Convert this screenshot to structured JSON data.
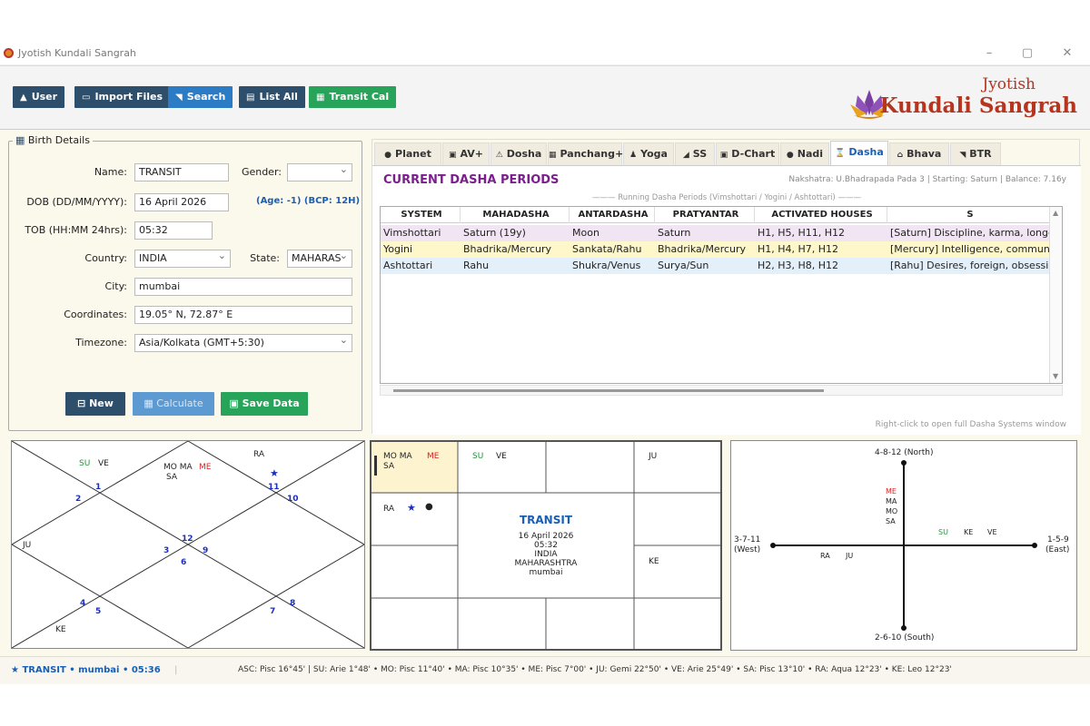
{
  "window": {
    "title": "Jyotish Kundali Sangrah",
    "minimize": "–",
    "maximize": "▢",
    "close": "✕"
  },
  "toolbar": {
    "buttons": [
      {
        "label": "User",
        "icon": "user-icon",
        "glyph": "▲",
        "color": "#2d4f6c"
      },
      {
        "label": "Import Files",
        "icon": "folder-icon",
        "glyph": "▭",
        "color": "#2d4f6c"
      },
      {
        "label": "Search",
        "icon": "search-icon",
        "glyph": "◥",
        "color": "#2b7cc4"
      },
      {
        "label": "List All",
        "icon": "list-icon",
        "glyph": "▤",
        "color": "#2d4f6c"
      },
      {
        "label": "Transit Cal",
        "icon": "calendar-icon",
        "glyph": "▦",
        "color": "#27a35a"
      }
    ]
  },
  "logo": {
    "line1": "Jyotish",
    "line2": "Kundali Sangrah"
  },
  "birth": {
    "legend": "Birth Details",
    "name_label": "Name:",
    "name_value": "TRANSIT",
    "gender_label": "Gender:",
    "gender_value": "",
    "dob_label": "DOB (DD/MM/YYYY):",
    "dob_value": "16 April 2026",
    "age_text": "(Age: -1) (BCP: 12H)",
    "tob_label": "TOB (HH:MM 24hrs):",
    "tob_value": "05:32",
    "country_label": "Country:",
    "country_value": "INDIA",
    "state_label": "State:",
    "state_value": "MAHARAS",
    "city_label": "City:",
    "city_value": "mumbai",
    "coord_label": "Coordinates:",
    "coord_value": "19.05° N, 72.87° E",
    "tz_label": "Timezone:",
    "tz_value": "Asia/Kolkata (GMT+5:30)",
    "new_label": "New",
    "calc_label": "Calculate",
    "save_label": "Save Data"
  },
  "tabs": [
    {
      "label": "Planet",
      "icon": "planet-icon",
      "glyph": "●"
    },
    {
      "label": "AV+",
      "icon": "av-icon",
      "glyph": "▣"
    },
    {
      "label": "Dosha",
      "icon": "warning-icon",
      "glyph": "⚠"
    },
    {
      "label": "Panchang+",
      "icon": "calendar-icon",
      "glyph": "▦"
    },
    {
      "label": "Yoga",
      "icon": "yoga-icon",
      "glyph": "♟"
    },
    {
      "label": "SS",
      "icon": "ss-icon",
      "glyph": "◢"
    },
    {
      "label": "D-Chart",
      "icon": "chart-icon",
      "glyph": "▣"
    },
    {
      "label": "Nadi",
      "icon": "nadi-icon",
      "glyph": "●"
    },
    {
      "label": "Dasha",
      "icon": "hourglass-icon",
      "glyph": "⌛",
      "active": true
    },
    {
      "label": "Bhava",
      "icon": "house-icon",
      "glyph": "⌂"
    },
    {
      "label": "BTR",
      "icon": "btr-icon",
      "glyph": "◥"
    }
  ],
  "dasha": {
    "title": "CURRENT DASHA PERIODS",
    "nakshatra": "Nakshatra: U.Bhadrapada Pada 3 | Starting: Saturn | Balance: 7.16y",
    "running": "——— Running Dasha Periods (Vimshottari / Yogini / Ashtottari) ———",
    "headers": [
      "SYSTEM",
      "MAHADASHA",
      "ANTARDASHA",
      "PRATYANTAR",
      "ACTIVATED HOUSES",
      "S"
    ],
    "rows": [
      {
        "bg": "#f1e4f3",
        "cells": [
          "Vimshottari",
          "Saturn (19y)",
          "Moon",
          "Saturn",
          "H1, H5, H11, H12",
          "[Saturn] Discipline, karma, longe"
        ]
      },
      {
        "bg": "#fdf7c9",
        "cells": [
          "Yogini",
          "Bhadrika/Mercury",
          "Sankata/Rahu",
          "Bhadrika/Mercury",
          "H1, H4, H7, H12",
          "[Mercury] Intelligence, communi"
        ]
      },
      {
        "bg": "#e3f0fa",
        "cells": [
          "Ashtottari",
          "Rahu",
          "Shukra/Venus",
          "Surya/Sun",
          "H2, H3, H8, H12",
          "[Rahu] Desires, foreign, obsessio"
        ]
      }
    ],
    "hint": "Right-click to open full Dasha Systems window"
  },
  "north_chart": {
    "houses": [
      {
        "num": "1"
      },
      {
        "num": "2"
      },
      {
        "num": "3"
      },
      {
        "num": "4"
      },
      {
        "num": "5"
      },
      {
        "num": "6"
      },
      {
        "num": "7"
      },
      {
        "num": "8"
      },
      {
        "num": "9"
      },
      {
        "num": "10"
      },
      {
        "num": "11"
      },
      {
        "num": "12"
      }
    ],
    "planets": [
      {
        "text": "SU",
        "color": "#1e9a3a"
      },
      {
        "text": "VE",
        "color": "#222"
      },
      {
        "text": "MO MA",
        "color": "#222"
      },
      {
        "text": "ME",
        "color": "#e02020"
      },
      {
        "text": "SA",
        "color": "#222"
      },
      {
        "text": "RA",
        "color": "#222"
      },
      {
        "text": "JU",
        "color": "#222"
      },
      {
        "text": "KE",
        "color": "#222"
      }
    ]
  },
  "south_chart": {
    "center_title": "TRANSIT",
    "center_lines": [
      "16 April 2026",
      "05:32",
      "INDIA",
      "MAHARASHTRA",
      "mumbai"
    ],
    "cells": {
      "c0_a": "MO MA",
      "c0_b": "ME",
      "c0_c": "SA",
      "c1_a": "SU",
      "c1_b": "VE",
      "c3": "JU",
      "c4": "RA",
      "c11": "KE"
    }
  },
  "cross_chart": {
    "north": "4-8-12 (North)",
    "south": "2-6-10 (South)",
    "west": "3-7-11",
    "west2": "(West)",
    "east": "1-5-9",
    "east2": "(East)",
    "n_planets": [
      "ME",
      "MA",
      "MO",
      "SA"
    ],
    "e_planets": [
      "SU",
      "KE",
      "VE"
    ],
    "w_planets": [
      "RA",
      "JU"
    ]
  },
  "status": {
    "left": "★ TRANSIT • mumbai • 05:36",
    "sep": "|",
    "right": "ASC: Pisc 16°45'  |  SU: Arie 1°48'  •  MO: Pisc 11°40'  •  MA: Pisc 10°35'  •  ME: Pisc 7°00'  •  JU: Gemi 22°50'  •  VE: Arie 25°49'  •  SA: Pisc 13°10'  •  RA: Aqua 12°23'  •  KE: Leo 12°23'"
  }
}
